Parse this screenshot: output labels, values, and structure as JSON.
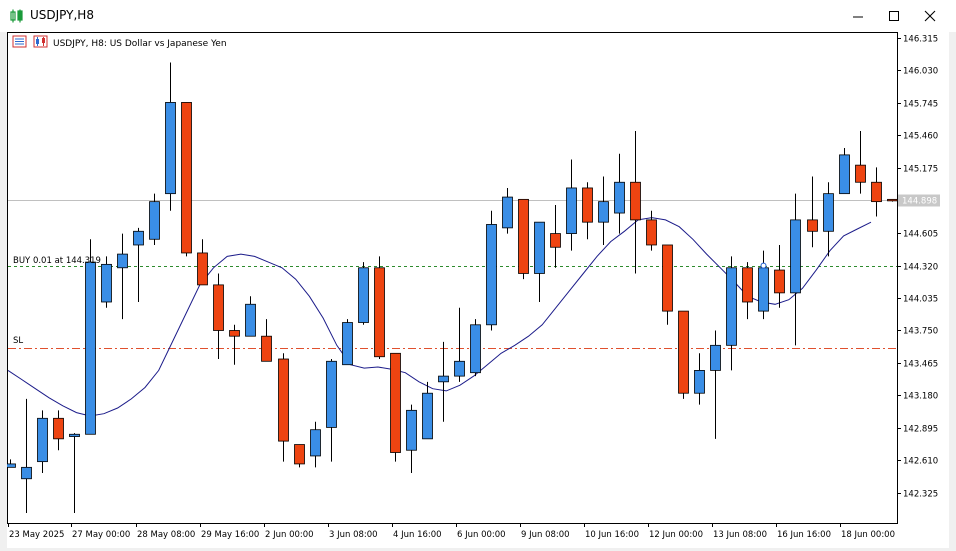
{
  "window": {
    "title": "USDJPY,H8"
  },
  "chart": {
    "header": "USDJPY, H8:  US Dollar vs Japanese Yen",
    "order_label": "BUY 0.01 at 144.319",
    "sl_label": "SL",
    "current_price": "144.898",
    "price_ticks": [
      "146.315",
      "146.030",
      "145.745",
      "145.460",
      "145.175",
      "144.605",
      "144.320",
      "144.035",
      "143.750",
      "143.465",
      "143.180",
      "142.895",
      "142.610",
      "142.325"
    ],
    "time_labels": [
      "23 May 2025",
      "27 May 00:00",
      "28 May 08:00",
      "29 May 16:00",
      "2 Jun 00:00",
      "3 Jun 08:00",
      "4 Jun 16:00",
      "6 Jun 00:00",
      "9 Jun 08:00",
      "10 Jun 16:00",
      "12 Jun 00:00",
      "13 Jun 08:00",
      "16 Jun 16:00",
      "18 Jun 00:00"
    ],
    "colors": {
      "bull": "#3a8ee6",
      "bear": "#ee4411",
      "ma": "#1c1c8a",
      "buy_line": "#2e8b2e",
      "sl_line": "#e0502e"
    }
  },
  "chart_data": {
    "type": "candlestick",
    "symbol": "USDJPY",
    "timeframe": "H8",
    "ylim": [
      142.13,
      146.38
    ],
    "order_price": 144.319,
    "stop_loss": 143.6,
    "current": 144.898,
    "ohlc": [
      [
        142.55,
        142.62,
        142.55,
        142.58
      ],
      [
        142.45,
        143.15,
        142.15,
        142.55
      ],
      [
        142.6,
        143.05,
        142.5,
        142.98
      ],
      [
        142.98,
        143.05,
        142.7,
        142.8
      ],
      [
        142.82,
        142.85,
        142.15,
        142.84
      ],
      [
        142.84,
        144.55,
        142.84,
        144.35
      ],
      [
        144.0,
        144.4,
        143.95,
        144.33
      ],
      [
        144.3,
        144.6,
        143.85,
        144.42
      ],
      [
        144.5,
        144.65,
        144.0,
        144.62
      ],
      [
        144.55,
        144.95,
        144.5,
        144.88
      ],
      [
        144.95,
        146.1,
        144.8,
        145.75
      ],
      [
        145.75,
        145.75,
        144.4,
        144.43
      ],
      [
        144.43,
        144.55,
        144.15,
        144.15
      ],
      [
        144.15,
        144.25,
        143.5,
        143.75
      ],
      [
        143.75,
        143.8,
        143.45,
        143.7
      ],
      [
        143.7,
        144.05,
        143.7,
        143.98
      ],
      [
        143.7,
        143.85,
        143.5,
        143.48
      ],
      [
        143.5,
        143.55,
        142.6,
        142.78
      ],
      [
        142.75,
        142.75,
        142.55,
        142.58
      ],
      [
        142.65,
        142.95,
        142.55,
        142.88
      ],
      [
        142.9,
        143.5,
        142.6,
        143.48
      ],
      [
        143.45,
        143.85,
        143.45,
        143.82
      ],
      [
        143.82,
        144.35,
        143.8,
        144.3
      ],
      [
        144.3,
        144.4,
        143.5,
        143.52
      ],
      [
        143.55,
        143.55,
        142.6,
        142.68
      ],
      [
        142.7,
        143.1,
        142.5,
        143.05
      ],
      [
        142.8,
        143.3,
        142.8,
        143.2
      ],
      [
        143.3,
        143.65,
        142.95,
        143.35
      ],
      [
        143.35,
        143.95,
        143.3,
        143.48
      ],
      [
        143.38,
        143.85,
        143.35,
        143.8
      ],
      [
        143.8,
        144.8,
        143.75,
        144.68
      ],
      [
        144.65,
        145.0,
        144.6,
        144.92
      ],
      [
        144.9,
        144.9,
        144.2,
        144.25
      ],
      [
        144.25,
        144.7,
        144.0,
        144.7
      ],
      [
        144.6,
        144.85,
        144.3,
        144.48
      ],
      [
        144.6,
        145.25,
        144.45,
        145.0
      ],
      [
        145.0,
        145.05,
        144.55,
        144.7
      ],
      [
        144.7,
        145.1,
        144.5,
        144.88
      ],
      [
        144.78,
        145.3,
        144.6,
        145.05
      ],
      [
        145.05,
        145.5,
        144.25,
        144.72
      ],
      [
        144.72,
        144.8,
        144.45,
        144.5
      ],
      [
        144.5,
        144.5,
        143.8,
        143.92
      ],
      [
        143.92,
        143.92,
        143.15,
        143.2
      ],
      [
        143.2,
        143.55,
        143.1,
        143.4
      ],
      [
        143.4,
        143.75,
        142.8,
        143.62
      ],
      [
        143.62,
        144.4,
        143.4,
        144.3
      ],
      [
        144.3,
        144.35,
        143.85,
        144.0
      ],
      [
        143.92,
        144.45,
        143.85,
        144.3
      ],
      [
        144.28,
        144.5,
        143.95,
        144.08
      ],
      [
        144.08,
        144.95,
        143.62,
        144.72
      ],
      [
        144.72,
        145.1,
        144.48,
        144.62
      ],
      [
        144.62,
        145.05,
        144.4,
        144.95
      ],
      [
        144.95,
        145.35,
        144.95,
        145.29
      ],
      [
        145.2,
        145.5,
        144.95,
        145.05
      ],
      [
        145.05,
        145.18,
        144.75,
        144.88
      ],
      [
        144.9,
        144.9,
        144.88,
        144.89
      ]
    ],
    "ma": [
      143.4,
      143.32,
      143.24,
      143.16,
      143.09,
      143.03,
      143.0,
      143.02,
      143.07,
      143.15,
      143.25,
      143.4,
      143.65,
      143.9,
      144.15,
      144.3,
      144.4,
      144.42,
      144.4,
      144.35,
      144.3,
      144.2,
      144.05,
      143.86,
      143.62,
      143.45,
      143.42,
      143.43,
      143.41,
      143.38,
      143.3,
      143.24,
      143.22,
      143.27,
      143.35,
      143.45,
      143.55,
      143.62,
      143.7,
      143.8,
      143.95,
      144.1,
      144.25,
      144.4,
      144.53,
      144.62,
      144.72,
      144.74,
      144.72,
      144.66,
      144.55,
      144.42,
      144.3,
      144.18,
      144.05,
      144.0,
      143.98,
      144.02,
      144.12,
      144.28,
      144.45,
      144.58,
      144.64,
      144.7
    ],
    "yticks": [
      146.315,
      146.03,
      145.745,
      145.46,
      145.175,
      144.605,
      144.32,
      144.035,
      143.75,
      143.465,
      143.18,
      142.895,
      142.61,
      142.325
    ],
    "xtick_labels": [
      "23 May 2025",
      "27 May 00:00",
      "28 May 08:00",
      "29 May 16:00",
      "2 Jun 00:00",
      "3 Jun 08:00",
      "4 Jun 16:00",
      "6 Jun 00:00",
      "9 Jun 08:00",
      "10 Jun 16:00",
      "12 Jun 00:00",
      "13 Jun 08:00",
      "16 Jun 16:00",
      "18 Jun 00:00"
    ]
  }
}
